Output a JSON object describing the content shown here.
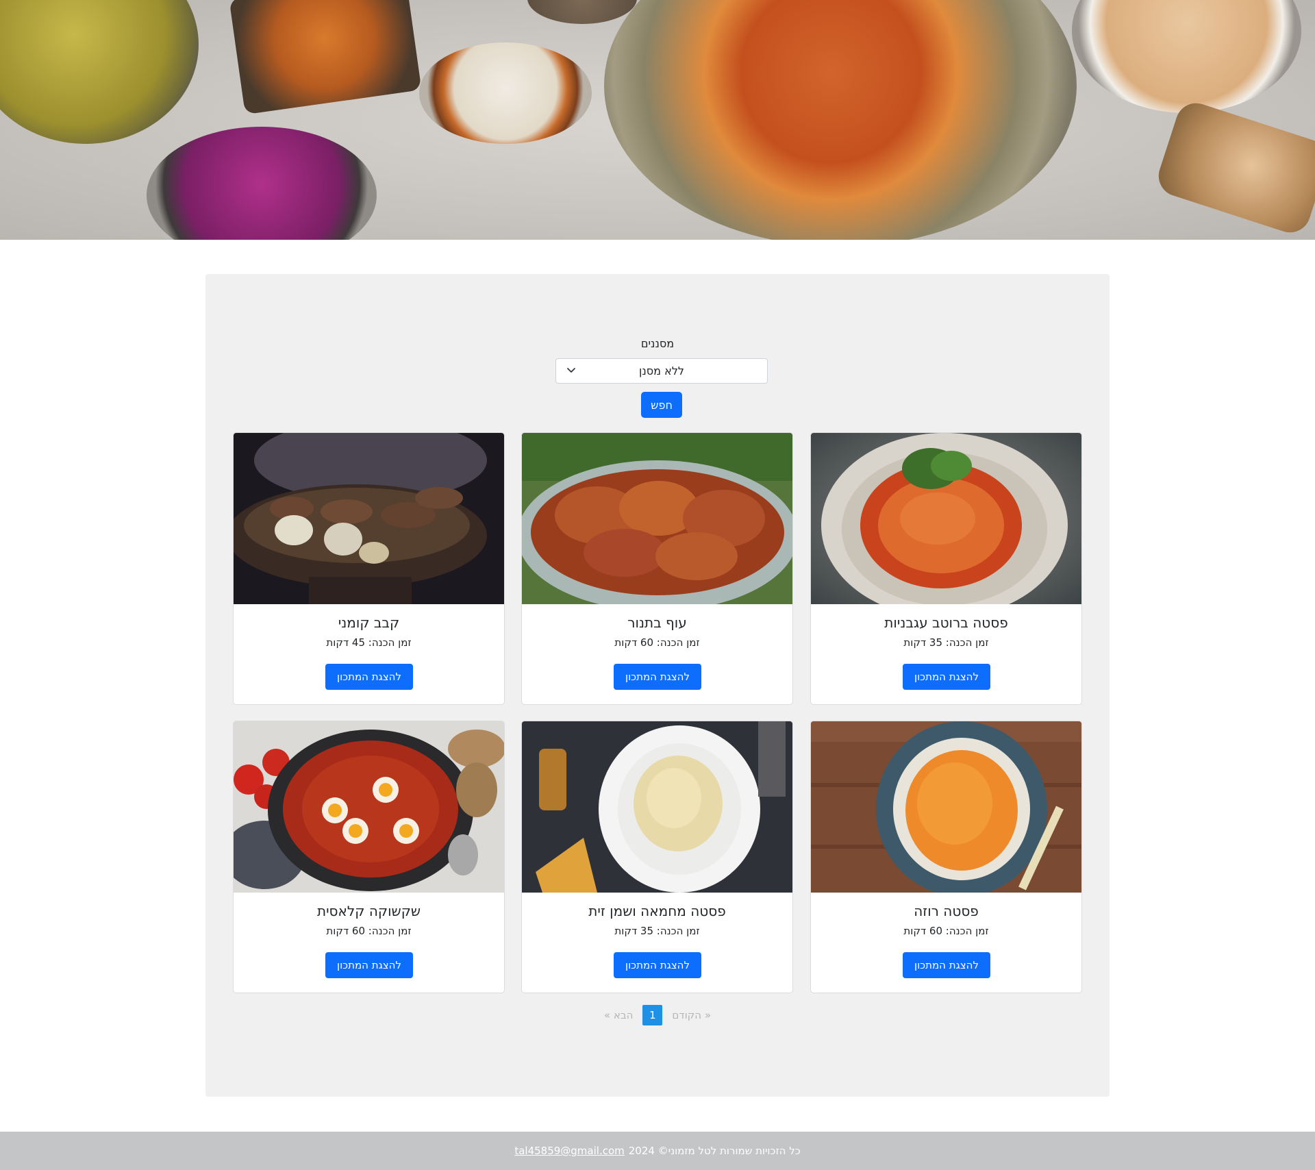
{
  "filters": {
    "label": "מסננים",
    "selected": "ללא מסנן",
    "search_label": "חפש"
  },
  "recipes": [
    {
      "title": "פסטה ברוטב עגבניות",
      "time": "זמן הכנה: 35 דקות",
      "button": "להצגת המתכון"
    },
    {
      "title": "עוף בתנור",
      "time": "זמן הכנה: 60 דקות",
      "button": "להצגת המתכון"
    },
    {
      "title": "קבב קומני",
      "time": "זמן הכנה: 45 דקות",
      "button": "להצגת המתכון"
    },
    {
      "title": "פסטה רוזה",
      "time": "זמן הכנה: 60 דקות",
      "button": "להצגת המתכון"
    },
    {
      "title": "פסטה מחמאה ושמן זית",
      "time": "זמן הכנה: 35 דקות",
      "button": "להצגת המתכון"
    },
    {
      "title": "שקשוקה קלאסית",
      "time": "זמן הכנה: 60 דקות",
      "button": "להצגת המתכון"
    }
  ],
  "pagination": {
    "prev": "« הקודם",
    "current": "1",
    "next": "הבא »"
  },
  "footer": {
    "copyright": "כל הזכויות שמורות לטל מזמוני© 2024",
    "email": "tal45859@gmail.com"
  },
  "colors": {
    "primary": "#0d6efd",
    "panel_bg": "#f0f0f0",
    "footer_bg": "#c4c5c7",
    "page_active": "#1e90e6"
  }
}
